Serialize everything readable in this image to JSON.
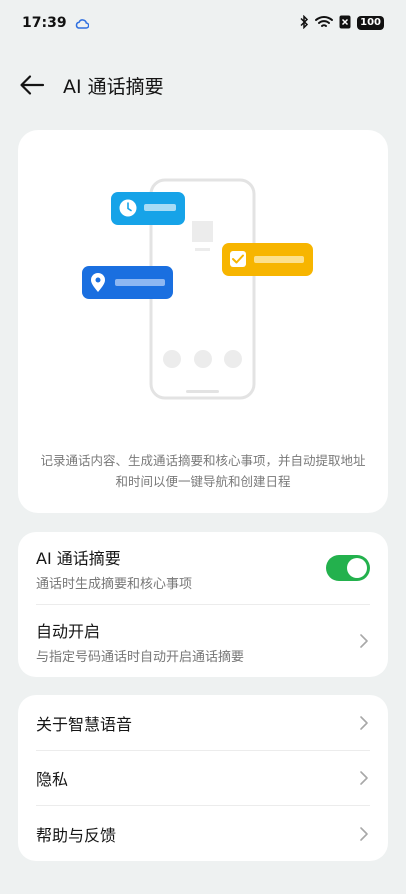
{
  "status_bar": {
    "time": "17:39",
    "battery": "100"
  },
  "header": {
    "title": "AI 通话摘要"
  },
  "illustration": {
    "description": "记录通话内容、生成通话摘要和核心事项，并自动提取地址和时间以便一键导航和创建日程"
  },
  "group1": {
    "ai_summary": {
      "title": "AI 通话摘要",
      "subtitle": "通话时生成摘要和核心事项",
      "enabled": true
    },
    "auto_start": {
      "title": "自动开启",
      "subtitle": "与指定号码通话时自动开启通话摘要"
    }
  },
  "group2": {
    "items": [
      {
        "label": "关于智慧语音"
      },
      {
        "label": "隐私"
      },
      {
        "label": "帮助与反馈"
      }
    ]
  },
  "colors": {
    "toggle_on": "#23b14d",
    "bubble_blue": "#1a6fe0",
    "bubble_sky": "#16a3e8",
    "bubble_yellow": "#f7b500"
  },
  "icons": [
    "back-arrow-icon",
    "bluetooth-icon",
    "wifi-icon",
    "sim-off-icon",
    "clock-icon",
    "checkbox-icon",
    "location-pin-icon",
    "chevron-right-icon"
  ]
}
